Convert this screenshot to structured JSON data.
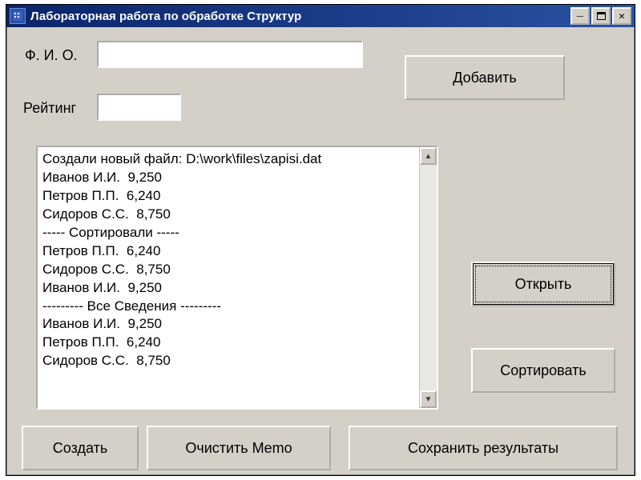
{
  "window": {
    "title": "Лабораторная работа по обработке Структур"
  },
  "labels": {
    "fio": "Ф. И. О.",
    "rating": "Рейтинг"
  },
  "inputs": {
    "fio_value": "",
    "rating_value": ""
  },
  "buttons": {
    "add": "Добавить",
    "open": "Открыть",
    "sort": "Сортировать",
    "create": "Создать",
    "clear_memo": "Очистить Memo",
    "save_results": "Сохранить результаты"
  },
  "memo": {
    "lines": [
      "Создали новый файл: D:\\work\\files\\zapisi.dat",
      "Иванов И.И.  9,250",
      "Петров П.П.  6,240",
      "Сидоров С.С.  8,750",
      "----- Сортировали -----",
      "Петров П.П.  6,240",
      "Сидоров С.С.  8,750",
      "Иванов И.И.  9,250",
      "--------- Все Сведения ---------",
      "Иванов И.И.  9,250",
      "Петров П.П.  6,240",
      "Сидоров С.С.  8,750"
    ]
  }
}
